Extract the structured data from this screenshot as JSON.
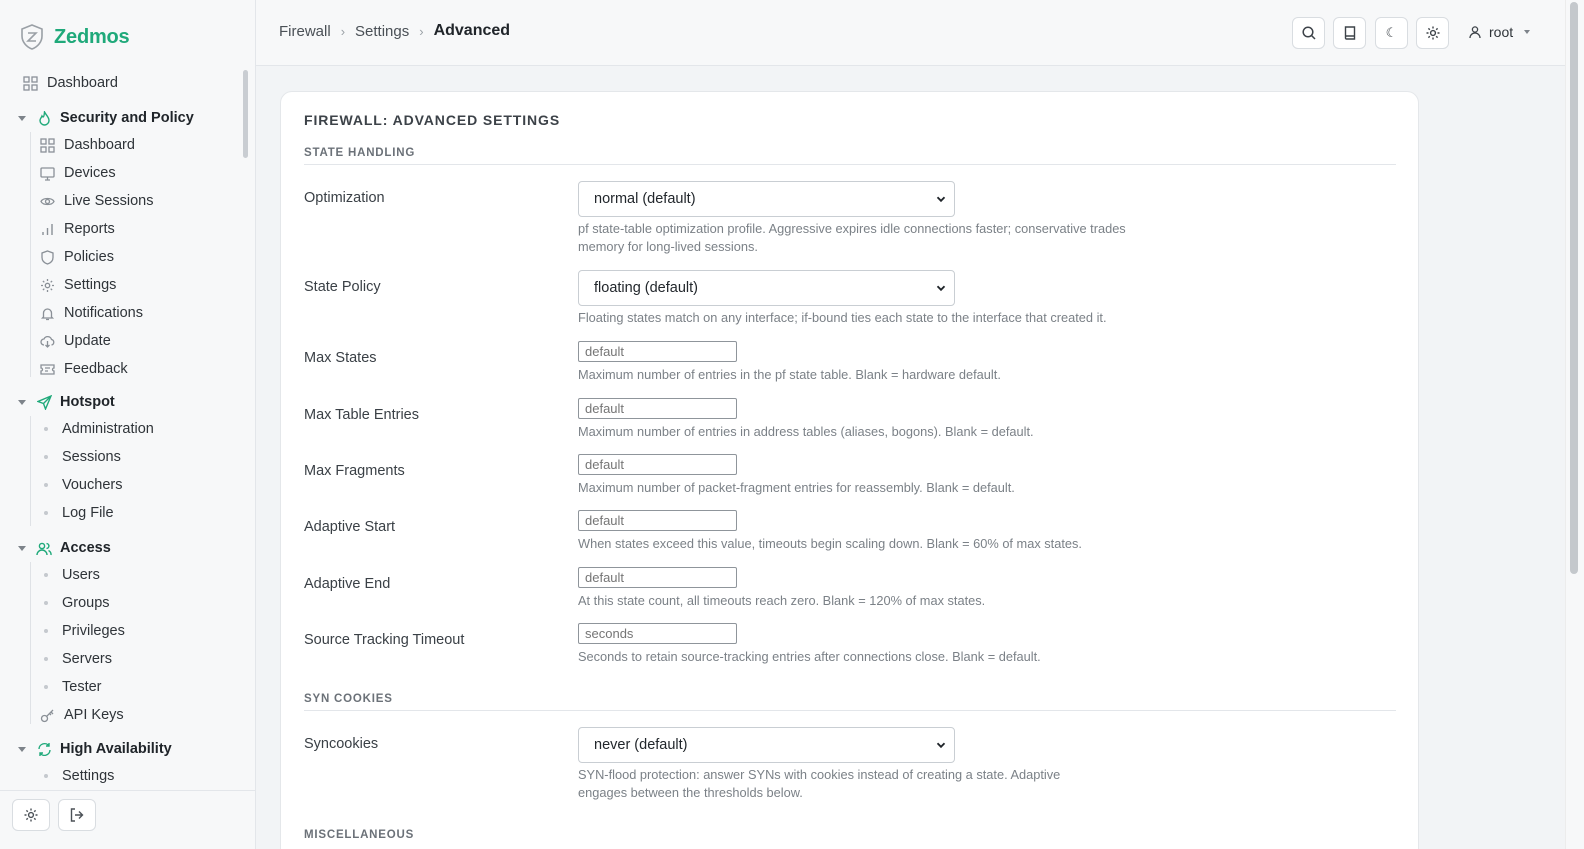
{
  "brand": {
    "name": "Zedmos"
  },
  "sidebar": {
    "top_item": "Dashboard",
    "sections": [
      {
        "label": "Security and Policy",
        "items": [
          "Dashboard",
          "Devices",
          "Live Sessions",
          "Reports",
          "Policies",
          "Settings",
          "Notifications",
          "Update",
          "Feedback"
        ]
      },
      {
        "label": "Hotspot",
        "items": [
          "Administration",
          "Sessions",
          "Vouchers",
          "Log File"
        ]
      },
      {
        "label": "Access",
        "items": [
          "Users",
          "Groups",
          "Privileges",
          "Servers",
          "Tester",
          "API Keys"
        ]
      },
      {
        "label": "High Availability",
        "items": [
          "Settings"
        ]
      }
    ]
  },
  "breadcrumb": {
    "items": [
      "Firewall",
      "Settings"
    ],
    "current": "Advanced"
  },
  "user": {
    "name": "root"
  },
  "page": {
    "title": "FIREWALL: ADVANCED SETTINGS",
    "sections": {
      "state_handling": "STATE HANDLING",
      "syn_cookies": "SYN COOKIES",
      "misc": "MISCELLANEOUS"
    },
    "fields": {
      "optimization": {
        "label": "Optimization",
        "value": "normal (default)",
        "help": "pf state-table optimization profile. Aggressive expires idle connections faster; conservative trades memory for long-lived sessions."
      },
      "state_policy": {
        "label": "State Policy",
        "value": "floating (default)",
        "help": "Floating states match on any interface; if-bound ties each state to the interface that created it."
      },
      "max_states": {
        "label": "Max States",
        "placeholder": "default",
        "help": "Maximum number of entries in the pf state table. Blank = hardware default."
      },
      "max_table_entries": {
        "label": "Max Table Entries",
        "placeholder": "default",
        "help": "Maximum number of entries in address tables (aliases, bogons). Blank = default."
      },
      "max_fragments": {
        "label": "Max Fragments",
        "placeholder": "default",
        "help": "Maximum number of packet-fragment entries for reassembly. Blank = default."
      },
      "adaptive_start": {
        "label": "Adaptive Start",
        "placeholder": "default",
        "help": "When states exceed this value, timeouts begin scaling down. Blank = 60% of max states."
      },
      "adaptive_end": {
        "label": "Adaptive End",
        "placeholder": "default",
        "help": "At this state count, all timeouts reach zero. Blank = 120% of max states."
      },
      "source_tracking_timeout": {
        "label": "Source Tracking Timeout",
        "placeholder": "seconds",
        "help": "Seconds to retain source-tracking entries after connections close. Blank = default."
      },
      "syncookies": {
        "label": "Syncookies",
        "value": "never (default)",
        "help": "SYN-flood protection: answer SYNs with cookies instead of creating a state. Adaptive engages between the thresholds below."
      }
    }
  },
  "colors": {
    "accent": "#1fa97a",
    "background": "#f2f4f6",
    "sidebar": "#f7f8f9"
  }
}
